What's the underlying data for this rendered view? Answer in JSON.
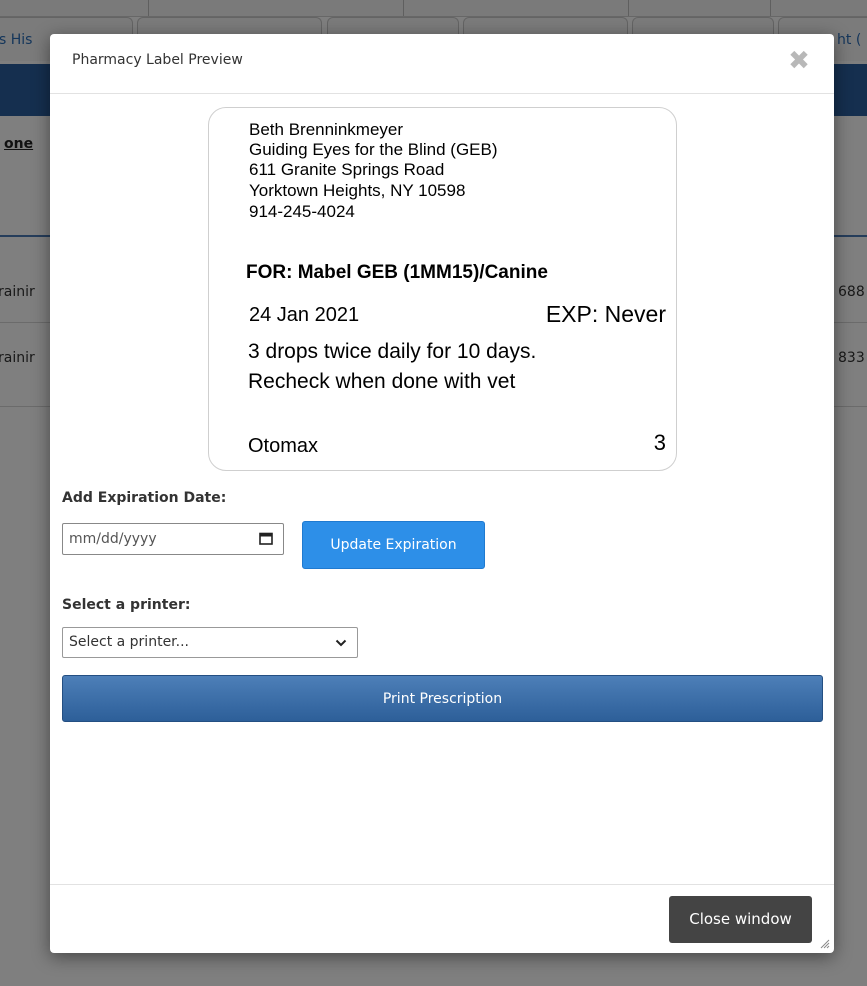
{
  "background": {
    "tabs": [
      {
        "label": "s His"
      },
      {
        "label": ""
      },
      {
        "label": ""
      },
      {
        "label": ""
      },
      {
        "label": ""
      },
      {
        "label": "ht ("
      }
    ],
    "done_label": "one",
    "rows": [
      {
        "left": "rainir",
        "right": "688"
      },
      {
        "left": "rainir",
        "right": "833"
      }
    ]
  },
  "modal": {
    "title": "Pharmacy Label Preview",
    "close_icon": "close-x-icon",
    "label_preview": {
      "address_lines": [
        "Beth Brenninkmeyer",
        "Guiding Eyes for the Blind (GEB)",
        "611 Granite Springs Road",
        "Yorktown Heights, NY 10598",
        "914-245-4024"
      ],
      "for_line": "FOR: Mabel GEB (1MM15)/Canine",
      "date": "24 Jan 2021",
      "expiration": "EXP: Never",
      "instructions": [
        "3 drops twice daily for 10 days.",
        "Recheck when done with vet"
      ],
      "drug": "Otomax",
      "quantity": "3"
    },
    "expiration": {
      "label": "Add Expiration Date:",
      "placeholder": "mm/dd/yyyy",
      "icon": "calendar-icon",
      "update_button": "Update Expiration"
    },
    "printer": {
      "label": "Select a printer:",
      "selected": "Select a printer...",
      "icon": "chevron-down-icon"
    },
    "print_button": "Print Prescription",
    "close_window_button": "Close window"
  },
  "colors": {
    "header_blue": "#2b5f9e",
    "update_button": "#2d8fe8",
    "print_button": "#2d5f99",
    "close_button": "#444444"
  }
}
